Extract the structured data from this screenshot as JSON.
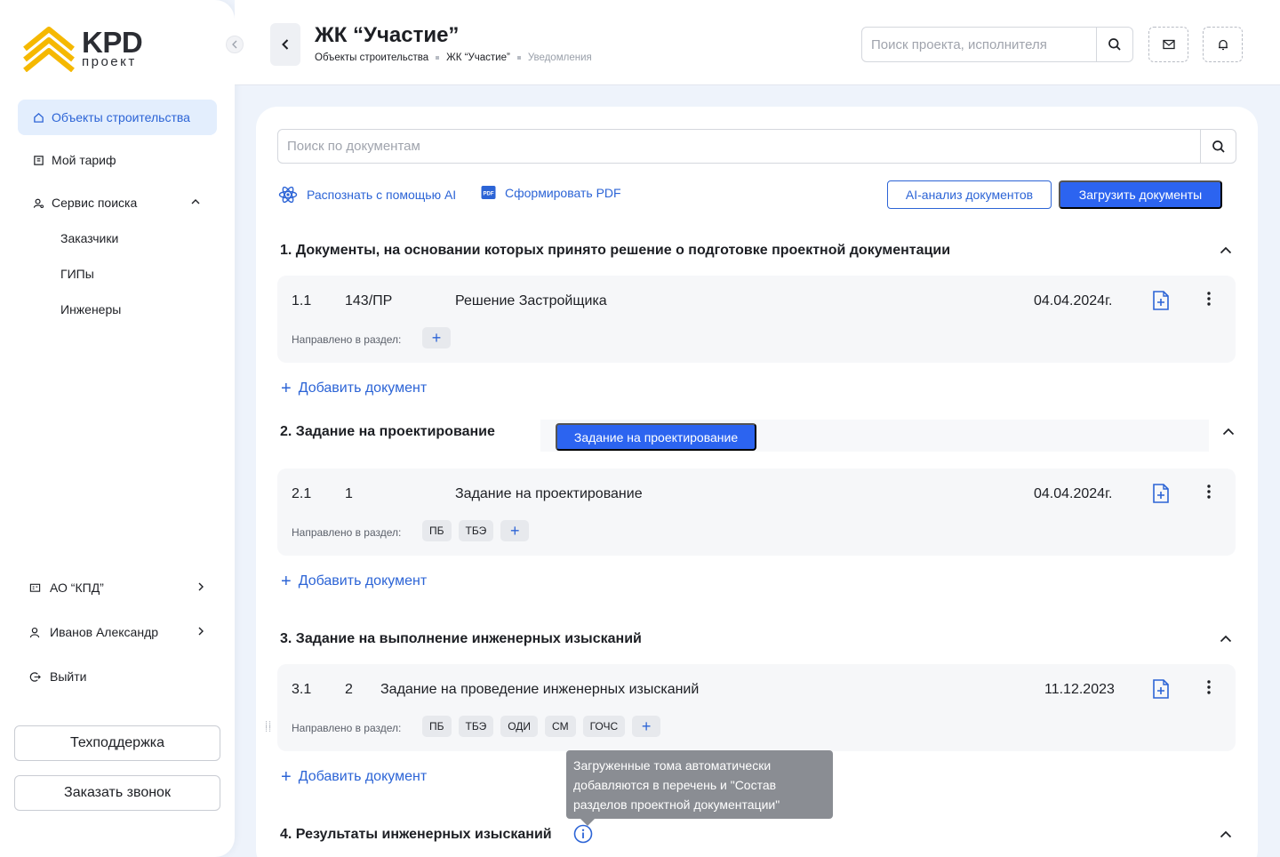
{
  "brand": {
    "name": "KPD",
    "sub": "проект"
  },
  "sidebar": {
    "items": [
      {
        "label": "Объекты строительства",
        "icon": "home-icon",
        "active": true
      },
      {
        "label": "Мой тариф",
        "icon": "tariff-icon"
      },
      {
        "label": "Сервис поиска",
        "icon": "user-search-icon",
        "expanded": true
      }
    ],
    "sub_items": [
      "Заказчики",
      "ГИПы",
      "Инженеры"
    ],
    "footer": [
      {
        "label": "АО “КПД”",
        "icon": "company-icon"
      },
      {
        "label": "Иванов Александр",
        "icon": "user-icon"
      },
      {
        "label": "Выйти",
        "icon": "logout-icon"
      }
    ],
    "support_label": "Техподдержка",
    "callback_label": "Заказать звонок"
  },
  "header": {
    "title": "ЖК “Участие”",
    "breadcrumb": [
      "Объекты строительства",
      "ЖК “Участие”",
      "Уведомления"
    ],
    "search_placeholder": "Поиск проекта, исполнителя"
  },
  "main": {
    "search_placeholder": "Поиск по документам",
    "recognize_label": "Распознать с помощью AI",
    "pdf_label": "Сформировать PDF",
    "ai_analysis_label": "AI-анализ документов",
    "upload_label": "Загрузить документы",
    "direction_label": "Направлено в раздел:",
    "add_doc_label": "Добавить документ",
    "sections": [
      {
        "title": "1. Документы, на основании которых принято решение о подготовке проектной документации",
        "doc": {
          "num": "1.1",
          "code": "143/ПР",
          "name": "Решение Застройщика",
          "date": "04.04.2024г."
        },
        "tags": []
      },
      {
        "title": "2. Задание на проектирование",
        "action_label": "Задание на проектирование",
        "doc": {
          "num": "2.1",
          "code": "1",
          "name": "Задание на проектирование",
          "date": "04.04.2024г."
        },
        "tags": [
          "ПБ",
          "ТБЭ"
        ]
      },
      {
        "title": "3. Задание на выполнение инженерных изысканий",
        "doc": {
          "num": "3.1",
          "code": "2",
          "name": "Задание на проведение инженерных изысканий",
          "date": "11.12.2023"
        },
        "tags": [
          "ПБ",
          "ТБЭ",
          "ОДИ",
          "СМ",
          "ГОЧС"
        ]
      },
      {
        "title": "4. Результаты инженерных изысканий"
      }
    ],
    "tooltip": "Загруженные тома автоматически добавляются в перечень и \"Состав разделов проектной документации\""
  },
  "colors": {
    "accent": "#2c64f0",
    "brand_yellow": "#f5b800",
    "link": "#2c64d6"
  }
}
